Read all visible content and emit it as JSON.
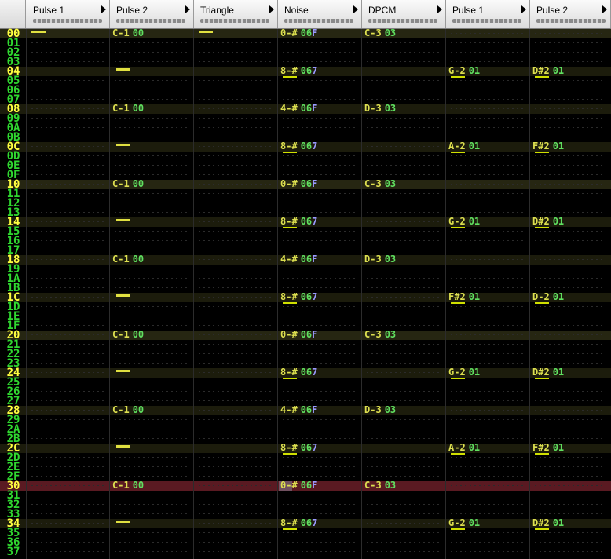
{
  "channels": [
    {
      "name": "Pulse 1"
    },
    {
      "name": "Pulse 2"
    },
    {
      "name": "Triangle"
    },
    {
      "name": "Noise"
    },
    {
      "name": "DPCM"
    },
    {
      "name": "Pulse 1"
    },
    {
      "name": "Pulse 2"
    }
  ],
  "cursor_row": "30",
  "rows": [
    {
      "num": "00",
      "cells": [
        {
          "dash": true
        },
        {
          "note": "C-1",
          "inst": "00"
        },
        {
          "dash": true
        },
        {
          "note": "0-#",
          "inst": "06",
          "vol": "F"
        },
        {
          "note": "C-3",
          "inst": "03"
        },
        {},
        {}
      ]
    },
    {
      "num": "01",
      "cells": [
        {},
        {},
        {},
        {},
        {},
        {},
        {}
      ]
    },
    {
      "num": "02",
      "cells": [
        {},
        {},
        {},
        {},
        {},
        {},
        {}
      ]
    },
    {
      "num": "03",
      "cells": [
        {},
        {},
        {},
        {},
        {},
        {},
        {}
      ]
    },
    {
      "num": "04",
      "cells": [
        {},
        {
          "dash": true
        },
        {},
        {
          "note": "8-#",
          "inst": "06",
          "vol": "7",
          "ul": true
        },
        {},
        {
          "note": "G-2",
          "inst": "01",
          "ul": true
        },
        {
          "note": "D#2",
          "inst": "01",
          "ul": true
        }
      ]
    },
    {
      "num": "05",
      "cells": [
        {},
        {},
        {},
        {},
        {},
        {},
        {}
      ]
    },
    {
      "num": "06",
      "cells": [
        {},
        {},
        {},
        {},
        {},
        {},
        {}
      ]
    },
    {
      "num": "07",
      "cells": [
        {},
        {},
        {},
        {},
        {},
        {},
        {}
      ]
    },
    {
      "num": "08",
      "cells": [
        {},
        {
          "note": "C-1",
          "inst": "00"
        },
        {},
        {
          "note": "4-#",
          "inst": "06",
          "vol": "F"
        },
        {
          "note": "D-3",
          "inst": "03"
        },
        {},
        {}
      ]
    },
    {
      "num": "09",
      "cells": [
        {},
        {},
        {},
        {},
        {},
        {},
        {}
      ]
    },
    {
      "num": "0A",
      "cells": [
        {},
        {},
        {},
        {},
        {},
        {},
        {}
      ]
    },
    {
      "num": "0B",
      "cells": [
        {},
        {},
        {},
        {},
        {},
        {},
        {}
      ]
    },
    {
      "num": "0C",
      "cells": [
        {},
        {
          "dash": true
        },
        {},
        {
          "note": "8-#",
          "inst": "06",
          "vol": "7",
          "ul": true
        },
        {},
        {
          "note": "A-2",
          "inst": "01",
          "ul": true
        },
        {
          "note": "F#2",
          "inst": "01",
          "ul": true
        }
      ]
    },
    {
      "num": "0D",
      "cells": [
        {},
        {},
        {},
        {},
        {},
        {},
        {}
      ]
    },
    {
      "num": "0E",
      "cells": [
        {},
        {},
        {},
        {},
        {},
        {},
        {}
      ]
    },
    {
      "num": "0F",
      "cells": [
        {},
        {},
        {},
        {},
        {},
        {},
        {}
      ]
    },
    {
      "num": "10",
      "cells": [
        {},
        {
          "note": "C-1",
          "inst": "00"
        },
        {},
        {
          "note": "0-#",
          "inst": "06",
          "vol": "F"
        },
        {
          "note": "C-3",
          "inst": "03"
        },
        {},
        {}
      ]
    },
    {
      "num": "11",
      "cells": [
        {},
        {},
        {},
        {},
        {},
        {},
        {}
      ]
    },
    {
      "num": "12",
      "cells": [
        {},
        {},
        {},
        {},
        {},
        {},
        {}
      ]
    },
    {
      "num": "13",
      "cells": [
        {},
        {},
        {},
        {},
        {},
        {},
        {}
      ]
    },
    {
      "num": "14",
      "cells": [
        {},
        {
          "dash": true
        },
        {},
        {
          "note": "8-#",
          "inst": "06",
          "vol": "7",
          "ul": true
        },
        {},
        {
          "note": "G-2",
          "inst": "01",
          "ul": true
        },
        {
          "note": "D#2",
          "inst": "01",
          "ul": true
        }
      ]
    },
    {
      "num": "15",
      "cells": [
        {},
        {},
        {},
        {},
        {},
        {},
        {}
      ]
    },
    {
      "num": "16",
      "cells": [
        {},
        {},
        {},
        {},
        {},
        {},
        {}
      ]
    },
    {
      "num": "17",
      "cells": [
        {},
        {},
        {},
        {},
        {},
        {},
        {}
      ]
    },
    {
      "num": "18",
      "cells": [
        {},
        {
          "note": "C-1",
          "inst": "00"
        },
        {},
        {
          "note": "4-#",
          "inst": "06",
          "vol": "F"
        },
        {
          "note": "D-3",
          "inst": "03"
        },
        {},
        {}
      ]
    },
    {
      "num": "19",
      "cells": [
        {},
        {},
        {},
        {},
        {},
        {},
        {}
      ]
    },
    {
      "num": "1A",
      "cells": [
        {},
        {},
        {},
        {},
        {},
        {},
        {}
      ]
    },
    {
      "num": "1B",
      "cells": [
        {},
        {},
        {},
        {},
        {},
        {},
        {}
      ]
    },
    {
      "num": "1C",
      "cells": [
        {},
        {
          "dash": true
        },
        {},
        {
          "note": "8-#",
          "inst": "06",
          "vol": "7",
          "ul": true
        },
        {},
        {
          "note": "F#2",
          "inst": "01",
          "ul": true
        },
        {
          "note": "D-2",
          "inst": "01",
          "ul": true
        }
      ]
    },
    {
      "num": "1D",
      "cells": [
        {},
        {},
        {},
        {},
        {},
        {},
        {}
      ]
    },
    {
      "num": "1E",
      "cells": [
        {},
        {},
        {},
        {},
        {},
        {},
        {}
      ]
    },
    {
      "num": "1F",
      "cells": [
        {},
        {},
        {},
        {},
        {},
        {},
        {}
      ]
    },
    {
      "num": "20",
      "cells": [
        {},
        {
          "note": "C-1",
          "inst": "00"
        },
        {},
        {
          "note": "0-#",
          "inst": "06",
          "vol": "F"
        },
        {
          "note": "C-3",
          "inst": "03"
        },
        {},
        {}
      ]
    },
    {
      "num": "21",
      "cells": [
        {},
        {},
        {},
        {},
        {},
        {},
        {}
      ]
    },
    {
      "num": "22",
      "cells": [
        {},
        {},
        {},
        {},
        {},
        {},
        {}
      ]
    },
    {
      "num": "23",
      "cells": [
        {},
        {},
        {},
        {},
        {},
        {},
        {}
      ]
    },
    {
      "num": "24",
      "cells": [
        {},
        {
          "dash": true
        },
        {},
        {
          "note": "8-#",
          "inst": "06",
          "vol": "7",
          "ul": true
        },
        {},
        {
          "note": "G-2",
          "inst": "01",
          "ul": true
        },
        {
          "note": "D#2",
          "inst": "01",
          "ul": true
        }
      ]
    },
    {
      "num": "25",
      "cells": [
        {},
        {},
        {},
        {},
        {},
        {},
        {}
      ]
    },
    {
      "num": "26",
      "cells": [
        {},
        {},
        {},
        {},
        {},
        {},
        {}
      ]
    },
    {
      "num": "27",
      "cells": [
        {},
        {},
        {},
        {},
        {},
        {},
        {}
      ]
    },
    {
      "num": "28",
      "cells": [
        {},
        {
          "note": "C-1",
          "inst": "00"
        },
        {},
        {
          "note": "4-#",
          "inst": "06",
          "vol": "F"
        },
        {
          "note": "D-3",
          "inst": "03"
        },
        {},
        {}
      ]
    },
    {
      "num": "29",
      "cells": [
        {},
        {},
        {},
        {},
        {},
        {},
        {}
      ]
    },
    {
      "num": "2A",
      "cells": [
        {},
        {},
        {},
        {},
        {},
        {},
        {}
      ]
    },
    {
      "num": "2B",
      "cells": [
        {},
        {},
        {},
        {},
        {},
        {},
        {}
      ]
    },
    {
      "num": "2C",
      "cells": [
        {},
        {
          "dash": true
        },
        {},
        {
          "note": "8-#",
          "inst": "06",
          "vol": "7",
          "ul": true
        },
        {},
        {
          "note": "A-2",
          "inst": "01",
          "ul": true
        },
        {
          "note": "F#2",
          "inst": "01",
          "ul": true
        }
      ]
    },
    {
      "num": "2D",
      "cells": [
        {},
        {},
        {},
        {},
        {},
        {},
        {}
      ]
    },
    {
      "num": "2E",
      "cells": [
        {},
        {},
        {},
        {},
        {},
        {},
        {}
      ]
    },
    {
      "num": "2F",
      "cells": [
        {},
        {},
        {},
        {},
        {},
        {},
        {}
      ]
    },
    {
      "num": "30",
      "cells": [
        {},
        {
          "note": "C-1",
          "inst": "00"
        },
        {},
        {
          "note": "0-#",
          "inst": "06",
          "vol": "F",
          "cursor": true
        },
        {
          "note": "C-3",
          "inst": "03"
        },
        {},
        {}
      ]
    },
    {
      "num": "31",
      "cells": [
        {},
        {},
        {},
        {},
        {},
        {},
        {}
      ]
    },
    {
      "num": "32",
      "cells": [
        {},
        {},
        {},
        {},
        {},
        {},
        {}
      ]
    },
    {
      "num": "33",
      "cells": [
        {},
        {},
        {},
        {},
        {},
        {},
        {}
      ]
    },
    {
      "num": "34",
      "cells": [
        {},
        {
          "dash": true
        },
        {},
        {
          "note": "8-#",
          "inst": "06",
          "vol": "7",
          "ul": true
        },
        {},
        {
          "note": "G-2",
          "inst": "01",
          "ul": true
        },
        {
          "note": "D#2",
          "inst": "01",
          "ul": true
        }
      ]
    },
    {
      "num": "35",
      "cells": [
        {},
        {},
        {},
        {},
        {},
        {},
        {}
      ]
    },
    {
      "num": "36",
      "cells": [
        {},
        {},
        {},
        {},
        {},
        {},
        {}
      ]
    },
    {
      "num": "37",
      "cells": [
        {},
        {},
        {},
        {},
        {},
        {},
        {}
      ]
    }
  ]
}
